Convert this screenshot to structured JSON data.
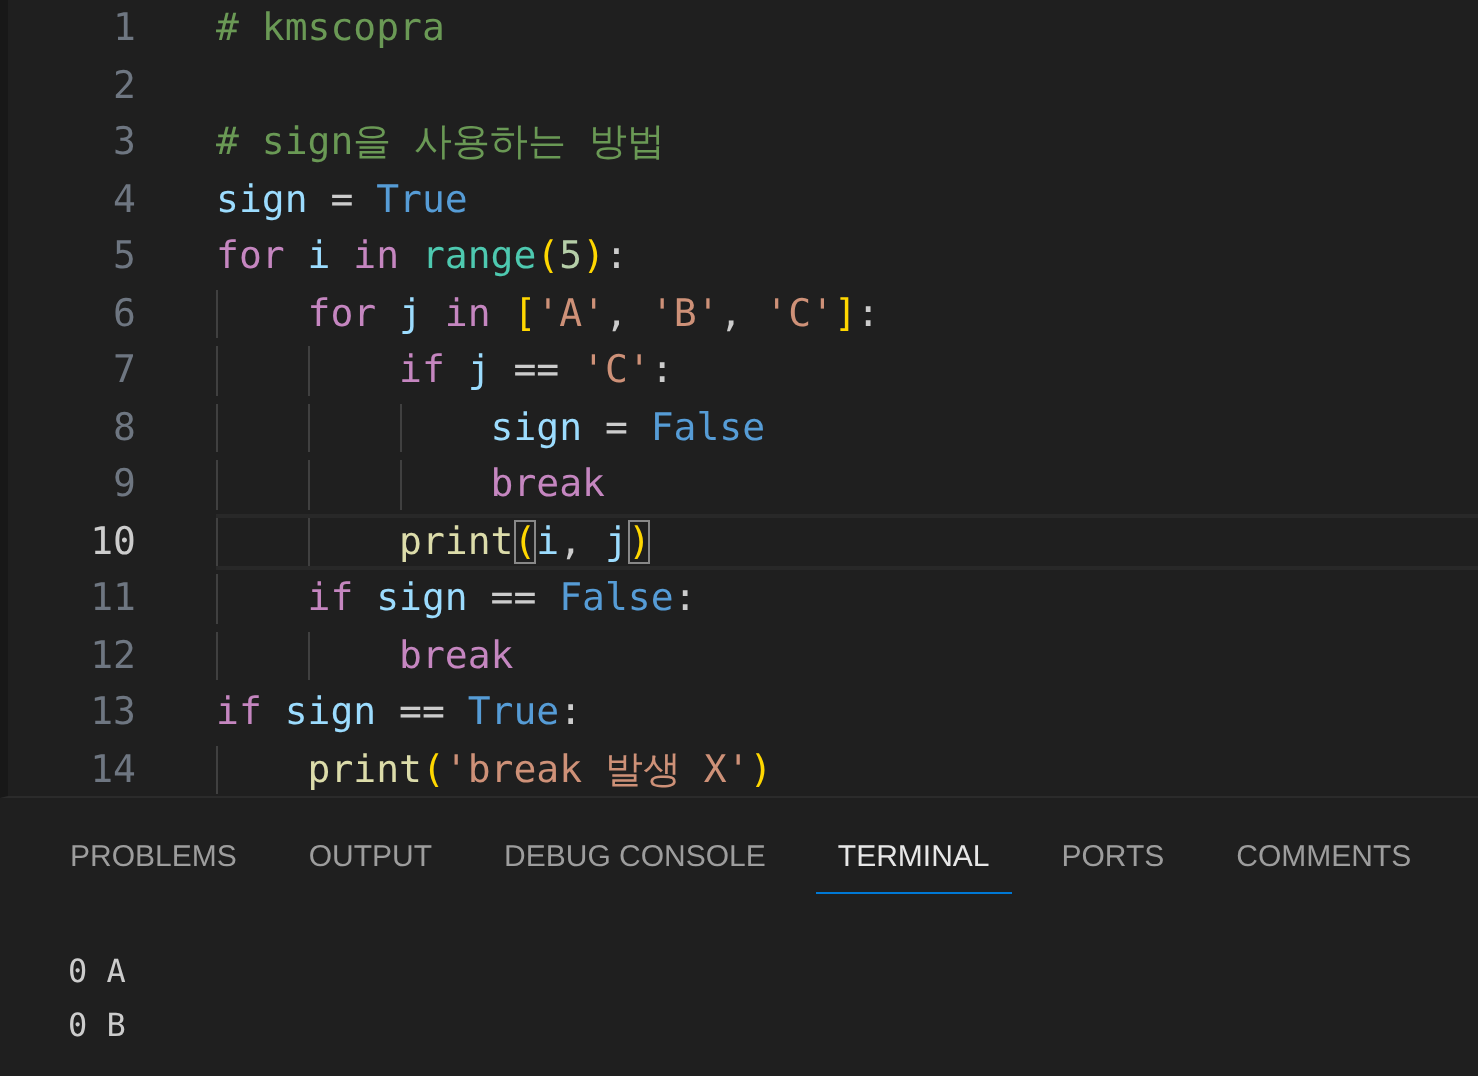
{
  "editor": {
    "lines": [
      {
        "number": "1",
        "current": false,
        "tokens": [
          {
            "text": "# kmscopra",
            "kind": "comment"
          }
        ]
      },
      {
        "number": "2",
        "current": false
      },
      {
        "number": "3",
        "current": false,
        "tokens": [
          {
            "text": "# sign을 사용하는 방법",
            "kind": "comment"
          }
        ]
      },
      {
        "number": "4",
        "current": false,
        "tokens": [
          {
            "text": "sign",
            "kind": "variable"
          },
          {
            "text": " =",
            "kind": "plain"
          },
          {
            "text": " True",
            "kind": "constant"
          }
        ]
      },
      {
        "number": "5",
        "current": false,
        "tokens": [
          {
            "text": "for",
            "kind": "keyword"
          },
          {
            "text": " i",
            "kind": "variable"
          },
          {
            "text": " in",
            "kind": "keyword"
          },
          {
            "text": " range",
            "kind": "builtin"
          },
          {
            "text": "(",
            "kind": "bracket"
          },
          {
            "text": "5",
            "kind": "number"
          },
          {
            "text": ")",
            "kind": "bracket"
          },
          {
            "text": ":",
            "kind": "plain"
          }
        ]
      },
      {
        "number": "6",
        "current": false,
        "tokens": [
          {
            "text": "    for",
            "kind": "keyword"
          },
          {
            "text": " j",
            "kind": "variable"
          },
          {
            "text": " in",
            "kind": "keyword"
          },
          {
            "text": " [",
            "kind": "bracket"
          },
          {
            "text": "'A'",
            "kind": "string"
          },
          {
            "text": ",",
            "kind": "plain"
          },
          {
            "text": " 'B'",
            "kind": "string"
          },
          {
            "text": ",",
            "kind": "plain"
          },
          {
            "text": " 'C'",
            "kind": "string"
          },
          {
            "text": "]",
            "kind": "bracket"
          },
          {
            "text": ":",
            "kind": "plain"
          }
        ]
      },
      {
        "number": "7",
        "current": false,
        "tokens": [
          {
            "text": "        if",
            "kind": "keyword"
          },
          {
            "text": " j",
            "kind": "variable"
          },
          {
            "text": " ==",
            "kind": "plain"
          },
          {
            "text": " 'C'",
            "kind": "string"
          },
          {
            "text": ":",
            "kind": "plain"
          }
        ]
      },
      {
        "number": "8",
        "current": false,
        "tokens": [
          {
            "text": "            sign",
            "kind": "variable"
          },
          {
            "text": " =",
            "kind": "plain"
          },
          {
            "text": " False",
            "kind": "constant"
          }
        ]
      },
      {
        "number": "9",
        "current": false,
        "tokens": [
          {
            "text": "            break",
            "kind": "keyword"
          }
        ]
      },
      {
        "number": "10",
        "current": true,
        "tokens": [
          {
            "text": "        print",
            "kind": "function"
          },
          {
            "text": "(",
            "kind": "bracket",
            "matched": true
          },
          {
            "text": "i",
            "kind": "variable"
          },
          {
            "text": ",",
            "kind": "plain"
          },
          {
            "text": " j",
            "kind": "variable"
          },
          {
            "text": ")",
            "kind": "bracket",
            "matched": true
          }
        ]
      },
      {
        "number": "11",
        "current": false,
        "tokens": [
          {
            "text": "    if",
            "kind": "keyword"
          },
          {
            "text": " sign",
            "kind": "variable"
          },
          {
            "text": " ==",
            "kind": "plain"
          },
          {
            "text": " False",
            "kind": "constant"
          },
          {
            "text": ":",
            "kind": "plain"
          }
        ]
      },
      {
        "number": "12",
        "current": false,
        "tokens": [
          {
            "text": "        break",
            "kind": "keyword"
          }
        ]
      },
      {
        "number": "13",
        "current": false,
        "tokens": [
          {
            "text": "if",
            "kind": "keyword"
          },
          {
            "text": " sign",
            "kind": "variable"
          },
          {
            "text": " ==",
            "kind": "plain"
          },
          {
            "text": " True",
            "kind": "constant"
          },
          {
            "text": ":",
            "kind": "plain"
          }
        ]
      },
      {
        "number": "14",
        "current": false,
        "tokens": [
          {
            "text": "    print",
            "kind": "function"
          },
          {
            "text": "(",
            "kind": "bracket"
          },
          {
            "text": "'break 발생 X'",
            "kind": "string"
          },
          {
            "text": ")",
            "kind": "bracket"
          }
        ]
      }
    ]
  },
  "panel": {
    "tabs": [
      {
        "label": "PROBLEMS",
        "selected": false
      },
      {
        "label": "OUTPUT",
        "selected": false
      },
      {
        "label": "DEBUG CONSOLE",
        "selected": false
      },
      {
        "label": "TERMINAL",
        "selected": true
      },
      {
        "label": "PORTS",
        "selected": false
      },
      {
        "label": "COMMENTS",
        "selected": false
      }
    ],
    "terminal_lines": [
      "0 A",
      "0 B"
    ]
  }
}
